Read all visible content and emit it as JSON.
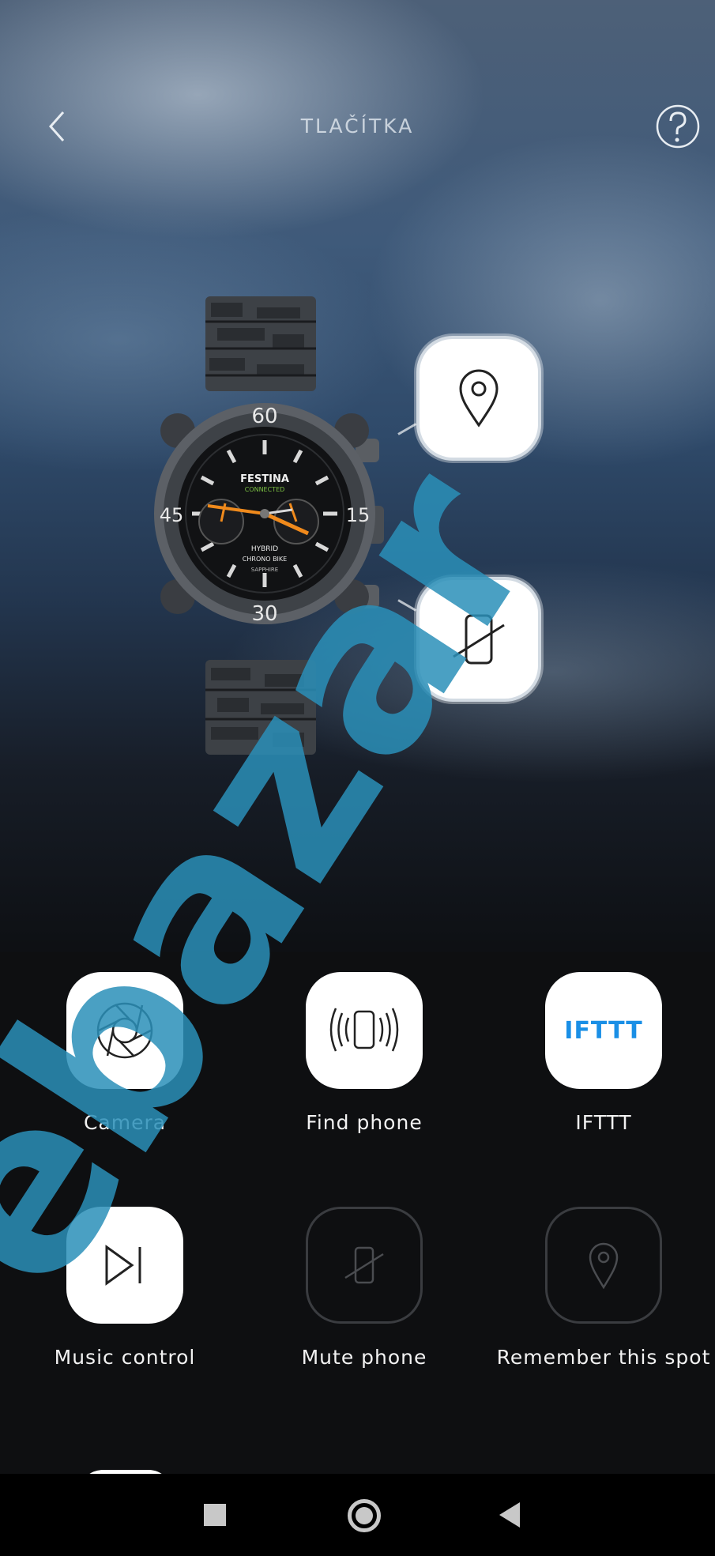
{
  "header": {
    "title": "TLAČÍTKA",
    "back_icon": "chevron-left-icon",
    "help_icon": "question-mark-icon"
  },
  "watch": {
    "brand": "FESTINA",
    "sub_brand": "CONNECTED",
    "model_line1": "HYBRID",
    "model_line2": "CHRONO BIKE",
    "model_line3": "SAPPHIRE",
    "bezel_numbers": [
      "60",
      "15",
      "30",
      "45"
    ],
    "top_button_icon": "location-pin-icon",
    "bottom_button_icon": "mute-phone-icon"
  },
  "functions": [
    {
      "label": "Camera",
      "icon": "camera-shutter-icon",
      "enabled": true
    },
    {
      "label": "Find phone",
      "icon": "vibrating-phone-icon",
      "enabled": true
    },
    {
      "label": "IFTTT",
      "icon": "ifttt-logo",
      "logo_text": "IFTTT",
      "enabled": true
    },
    {
      "label": "Music control",
      "icon": "play-next-icon",
      "enabled": true
    },
    {
      "label": "Mute phone",
      "icon": "mute-phone-icon",
      "enabled": false
    },
    {
      "label": "Remember this spot",
      "icon": "location-pin-icon",
      "enabled": false
    }
  ],
  "colors": {
    "ifttt_blue": "#1a8fe6",
    "accent_orange": "#f08a1c",
    "accent_green": "#7cc242",
    "watermark": "#2a8fb8"
  },
  "navbar": {
    "recent_icon": "square-icon",
    "home_icon": "circle-icon",
    "back_icon": "triangle-back-icon"
  },
  "watermark": {
    "text": "ebazar"
  }
}
